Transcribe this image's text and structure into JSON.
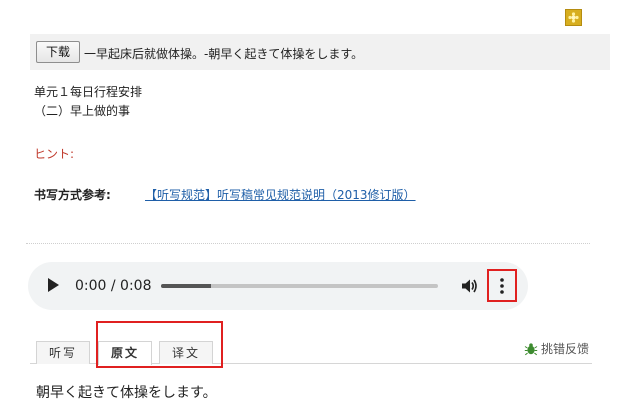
{
  "header": {
    "download_label": "下载",
    "sentence_title": "一早起床后就做体操。-朝早く起きて体操をします。"
  },
  "lesson": {
    "unit_title": "单元１每日行程安排",
    "unit_subtitle": "（二）早上做的事"
  },
  "hint": {
    "label": "ヒント:"
  },
  "rules": {
    "label": "书写方式参考:",
    "link_text": "【听写规范】听写稿常见规范说明（2013修订版）"
  },
  "audio": {
    "time_display": "0:00 / 0:08",
    "progress_fraction": 0.18
  },
  "tabs": [
    {
      "label": "听写",
      "active": false
    },
    {
      "label": "原文",
      "active": true
    },
    {
      "label": "译文",
      "active": false
    }
  ],
  "feedback": {
    "label": "挑错反馈"
  },
  "content": {
    "original_text": "朝早く起きて体操をします。"
  },
  "colors": {
    "highlight_box": "#e02020",
    "link": "#1f5fa8",
    "hint": "#c0392b"
  },
  "icons": {
    "corner": "flower-icon",
    "play": "play-icon",
    "volume": "volume-icon",
    "menu": "more-vert-icon",
    "feedback": "bug-icon"
  }
}
